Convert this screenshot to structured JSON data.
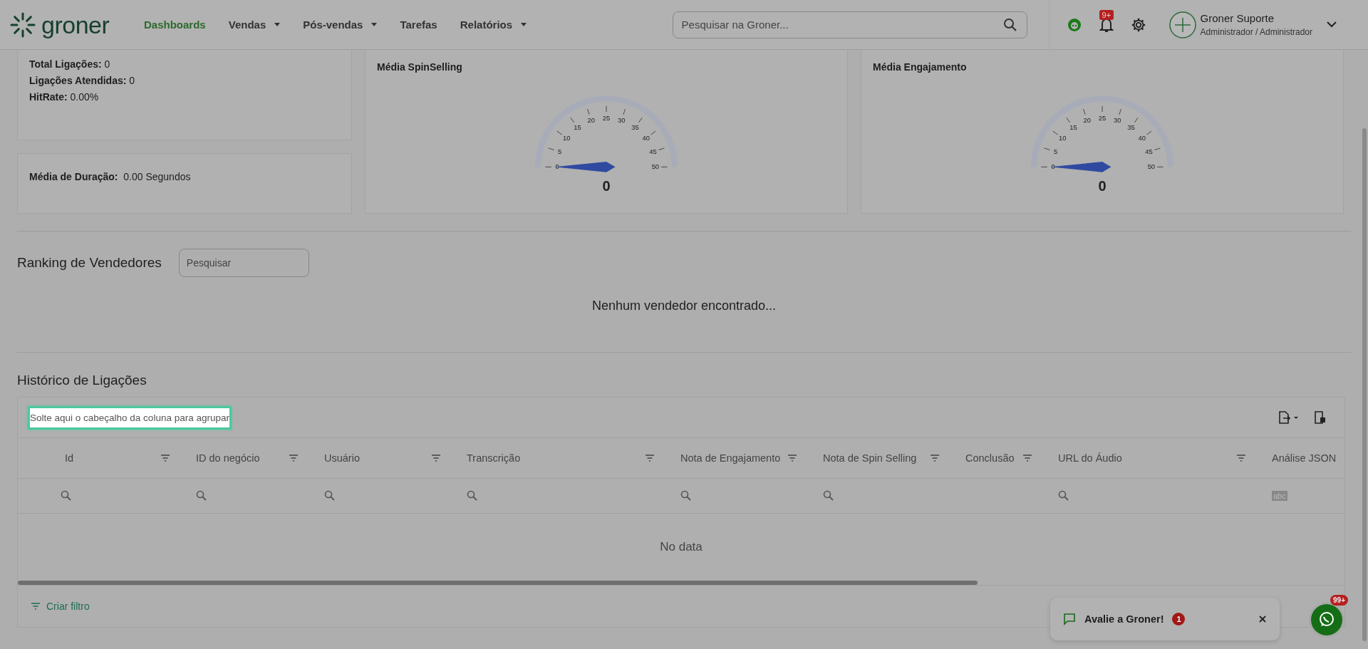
{
  "header": {
    "logo": "groner",
    "nav": [
      {
        "label": "Dashboards",
        "selected": true,
        "dropdown": false
      },
      {
        "label": "Vendas",
        "selected": false,
        "dropdown": true
      },
      {
        "label": "Pós-vendas",
        "selected": false,
        "dropdown": true
      },
      {
        "label": "Tarefas",
        "selected": false,
        "dropdown": false
      },
      {
        "label": "Relatórios",
        "selected": false,
        "dropdown": true
      }
    ],
    "search": {
      "placeholder": "Pesquisar na Groner..."
    },
    "notification_badge": "9+",
    "user": {
      "name": "Groner Suporte",
      "role": "Administrador / Administrador"
    }
  },
  "stats": [
    {
      "label": "Total Ligações:",
      "value": "0"
    },
    {
      "label": "Ligações Atendidas:",
      "value": "0"
    },
    {
      "label": "HitRate:",
      "value": "0.00%"
    }
  ],
  "duration": {
    "label": "Média de Duração:",
    "value": "0.00 Segundos"
  },
  "gauges": [
    {
      "title": "Média SpinSelling",
      "ticks": [
        "0",
        "5",
        "10",
        "15",
        "20",
        "25",
        "30",
        "35",
        "40",
        "45",
        "50"
      ],
      "value": "0"
    },
    {
      "title": "Média Engajamento",
      "ticks": [
        "0",
        "5",
        "10",
        "15",
        "20",
        "25",
        "30",
        "35",
        "40",
        "45",
        "50"
      ],
      "value": "0"
    }
  ],
  "ranking": {
    "title": "Ranking de Vendedores",
    "search": {
      "placeholder": "Pesquisar"
    },
    "empty": "Nenhum vendedor encontrado..."
  },
  "history": {
    "title": "Histórico de Ligações",
    "group_panel": "Solte aqui o cabeçalho da coluna para agrupar",
    "columns": [
      {
        "label": "Id",
        "filter_menu": true
      },
      {
        "label": "ID do negócio",
        "filter_menu": true
      },
      {
        "label": "Usuário",
        "filter_menu": true
      },
      {
        "label": "Transcrição",
        "filter_menu": true
      },
      {
        "label": "Nota de Engajamento",
        "filter_menu": true
      },
      {
        "label": "Nota de Spin Selling",
        "filter_menu": true
      },
      {
        "label": "Conclusão",
        "filter_menu": true
      },
      {
        "label": "URL do Áudio",
        "filter_menu": true
      },
      {
        "label": "Análise JSON",
        "filter_menu": false
      }
    ],
    "filter_row": [
      {
        "kind": "search"
      },
      {
        "kind": "search"
      },
      {
        "kind": "search"
      },
      {
        "kind": "search"
      },
      {
        "kind": "search"
      },
      {
        "kind": "search"
      },
      {
        "kind": "blank"
      },
      {
        "kind": "search"
      },
      {
        "kind": "text",
        "label": "abc"
      }
    ],
    "empty": "No data",
    "create_filter": "Criar filtro"
  },
  "toast": {
    "text": "Avalie a Groner!",
    "count": "1"
  },
  "chat_badge": "99+"
}
